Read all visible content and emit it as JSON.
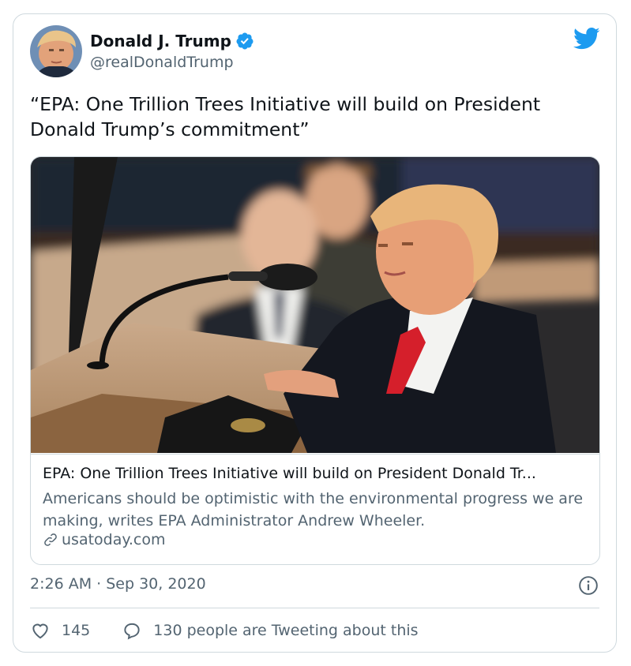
{
  "author": {
    "name": "Donald J. Trump",
    "handle": "@realDonaldTrump",
    "verified": true
  },
  "tweet": {
    "text": "“EPA: One Trillion Trees Initiative will build on President Donald Trump’s commitment”"
  },
  "link_card": {
    "title": "EPA: One Trillion Trees Initiative will build on President Donald Tr...",
    "description": "Americans should be optimistic with the environmental progress we are making, writes EPA Administrator Andrew Wheeler.",
    "domain": "usatoday.com",
    "image_icon": "photo-of-president-at-podium"
  },
  "meta": {
    "timestamp": "2:26 AM · Sep 30, 2020"
  },
  "actions": {
    "likes": "145",
    "replies_text": "130 people are Tweeting about this"
  },
  "colors": {
    "brand": "#1d9bf0",
    "text": "#0f1419",
    "secondary": "#536471",
    "border": "#cfd9de"
  },
  "icons": [
    "avatar",
    "verified-badge-icon",
    "twitter-bird-icon",
    "link-icon",
    "info-icon",
    "heart-icon",
    "reply-bubble-icon"
  ]
}
